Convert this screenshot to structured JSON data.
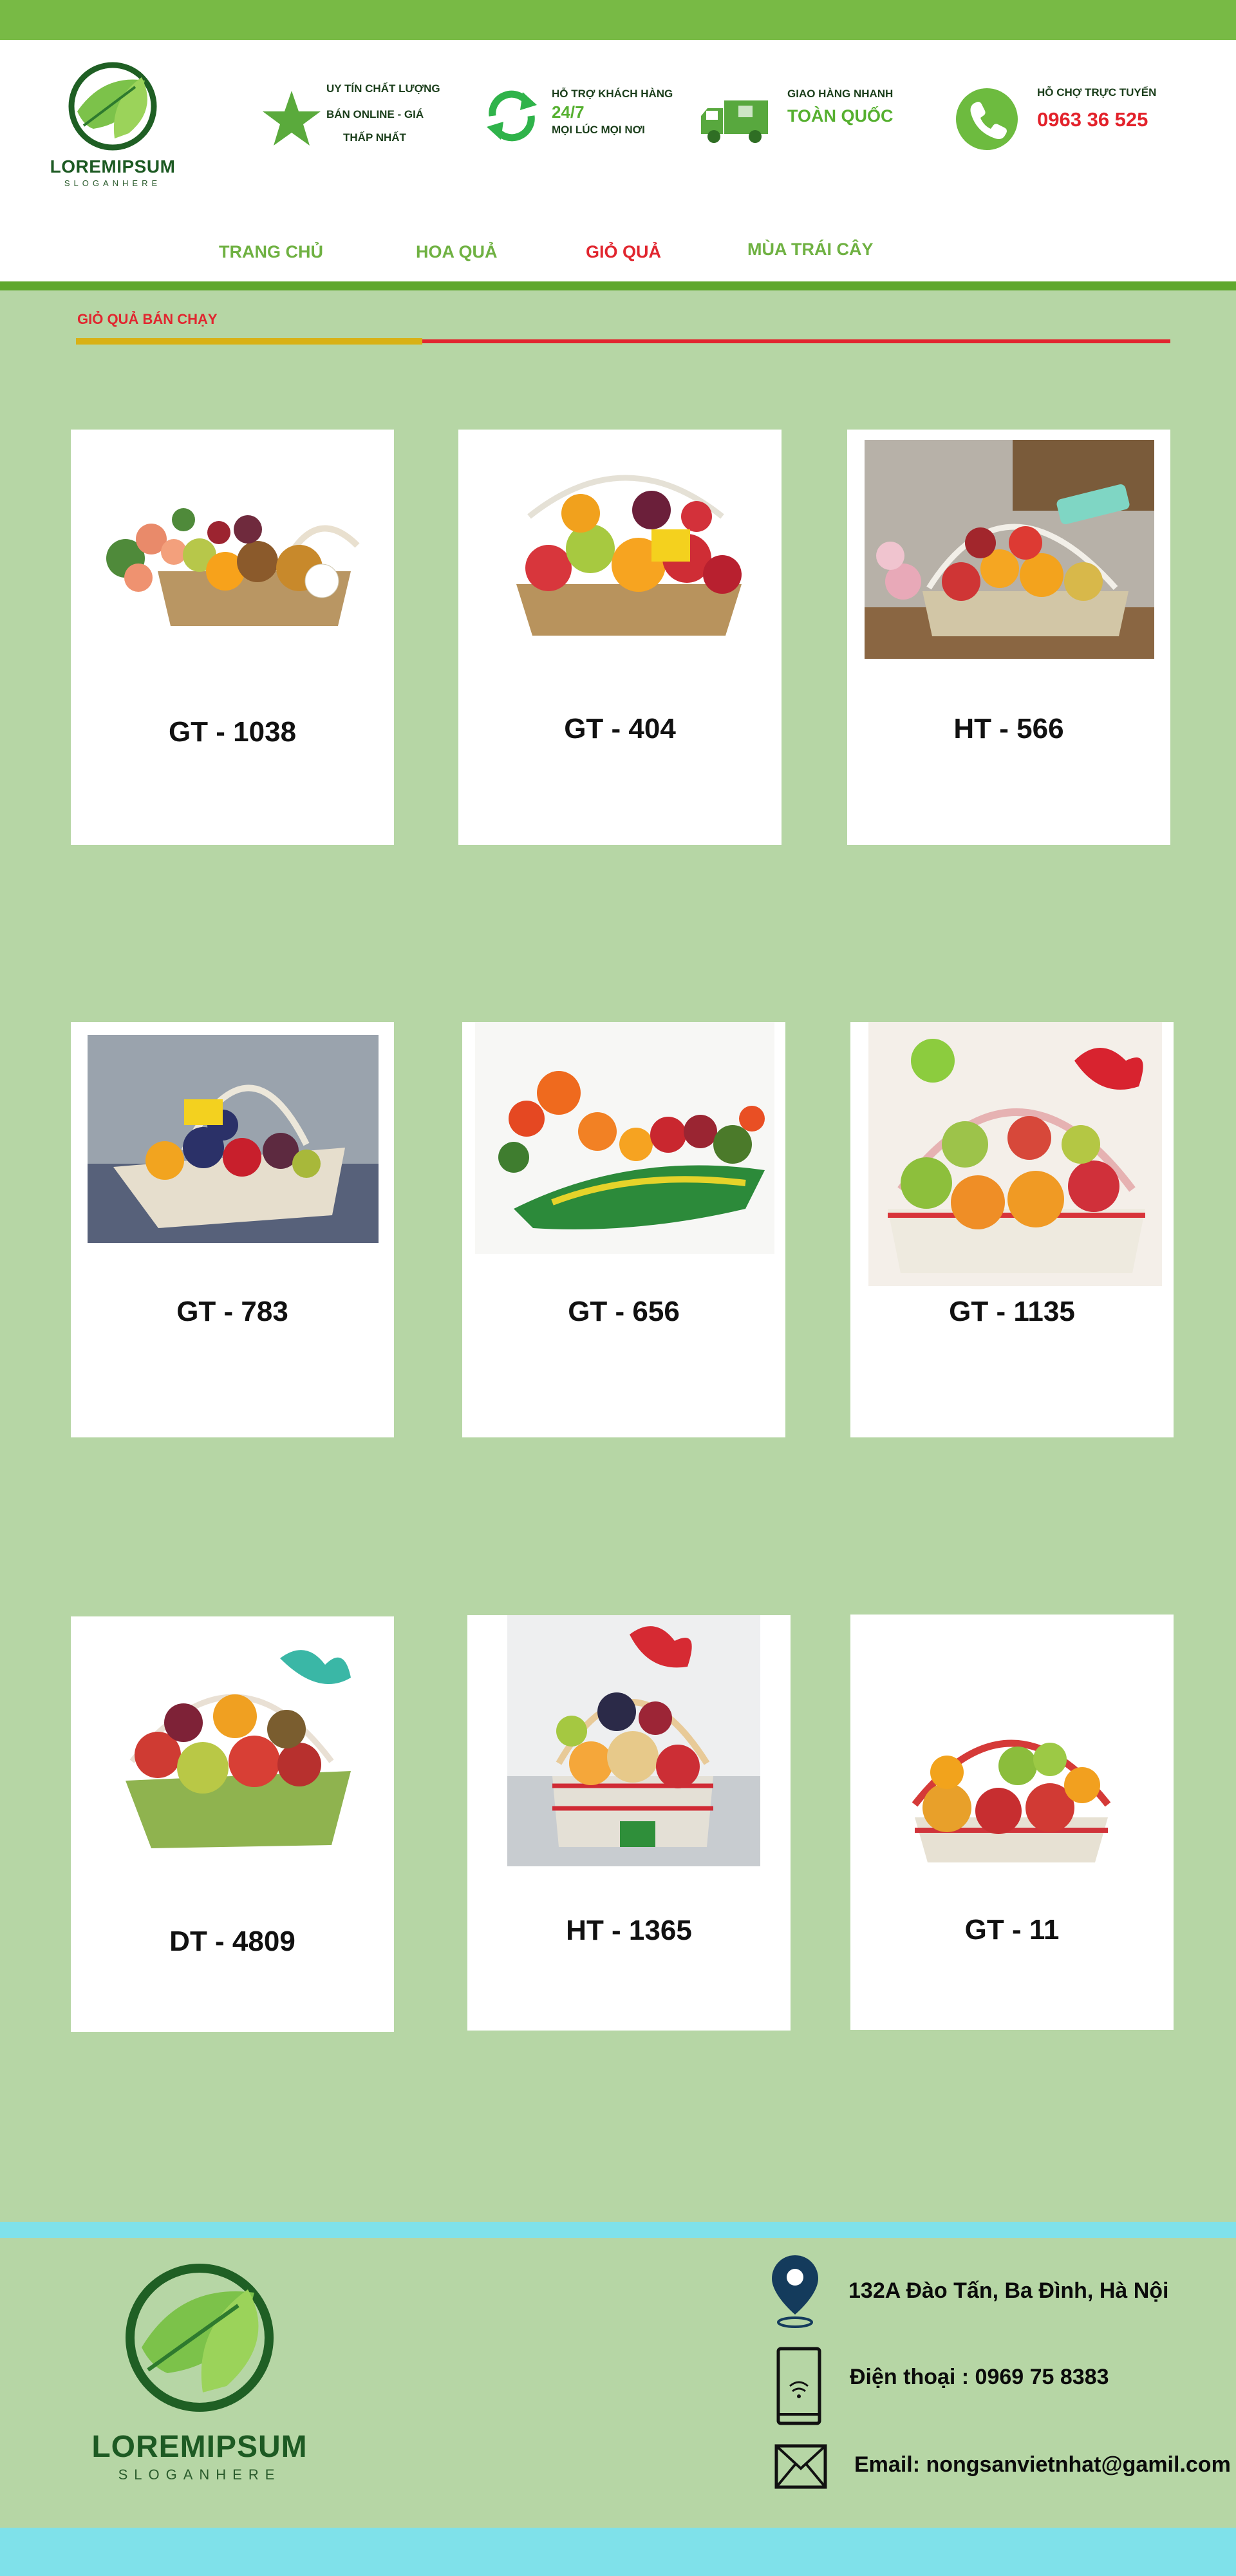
{
  "brand": {
    "name": "LOREMIPSUM",
    "slogan": "SLOGANHERE"
  },
  "features": [
    {
      "icon": "star-icon",
      "lines": [
        "UY TÍN CHẤT LƯỢNG",
        "BÁN ONLINE - GIÁ",
        "THẤP NHẤT"
      ]
    },
    {
      "icon": "refresh-24-7-icon",
      "lines": [
        "HỖ TRỢ KHÁCH HÀNG",
        "24/7",
        "MỌI LÚC MỌI NƠI"
      ]
    },
    {
      "icon": "delivery-truck-icon",
      "lines": [
        "GIAO HÀNG NHANH",
        "TOÀN QUỐC"
      ]
    },
    {
      "icon": "phone-icon",
      "lines": [
        "HỖ CHỢ TRỰC TUYẾN",
        "0963 36 525"
      ]
    }
  ],
  "nav": {
    "items": [
      "TRANG CHỦ",
      "HOA QUẢ",
      "GIỎ QUẢ",
      "MÙA TRÁI CÂY"
    ],
    "active": "GIỎ QUẢ"
  },
  "section": {
    "title": "GIỎ QUẢ BÁN CHẠY"
  },
  "products": [
    {
      "code": "GT - 1038"
    },
    {
      "code": "GT - 404"
    },
    {
      "code": "HT - 566"
    },
    {
      "code": "GT - 783"
    },
    {
      "code": "GT - 656"
    },
    {
      "code": "GT - 1135"
    },
    {
      "code": "DT - 4809"
    },
    {
      "code": "HT - 1365"
    },
    {
      "code": "GT - 11"
    }
  ],
  "footer": {
    "address": "132A Đào Tấn, Ba Đình, Hà Nội",
    "phone": "Điện thoại : 0969 75 8383",
    "email": "Email: nongsanvietnhat@gamil.com"
  },
  "colors": {
    "page_bg": "#b6d6a5",
    "top_bar": "#78ba45",
    "nav_text": "#6fb142",
    "accent_red": "#e1262f",
    "accent_yellow": "#d8b116",
    "footer_stripe": "#7fe1ea"
  }
}
